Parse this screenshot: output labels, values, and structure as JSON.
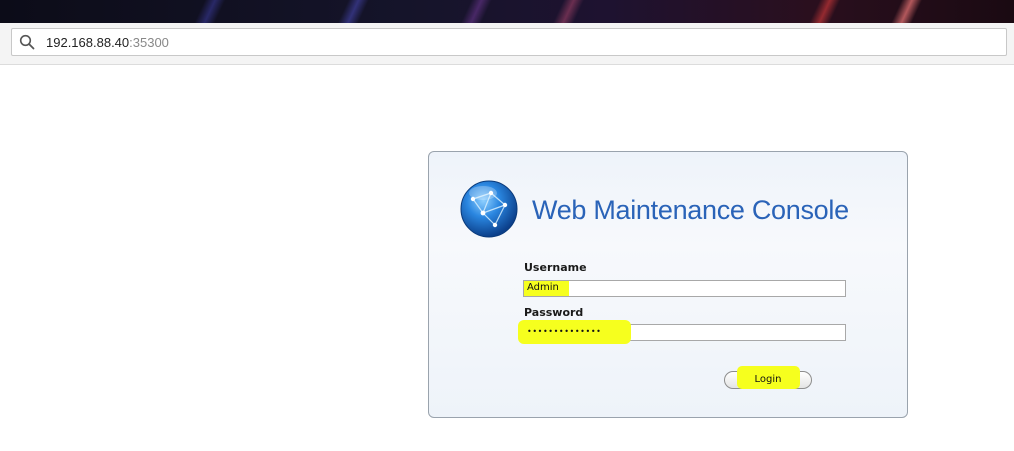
{
  "browser": {
    "url_host": "192.168.88.40",
    "url_port": ":35300",
    "search_icon": "search-icon"
  },
  "console": {
    "title": "Web Maintenance Console",
    "logo_icon": "globe-network-icon",
    "username_label": "Username",
    "username_value": "Admin",
    "password_label": "Password",
    "password_value": "••••••••••••••",
    "login_label": "Login",
    "highlight_color": "#f6ff1e",
    "title_color": "#2a63b8"
  }
}
